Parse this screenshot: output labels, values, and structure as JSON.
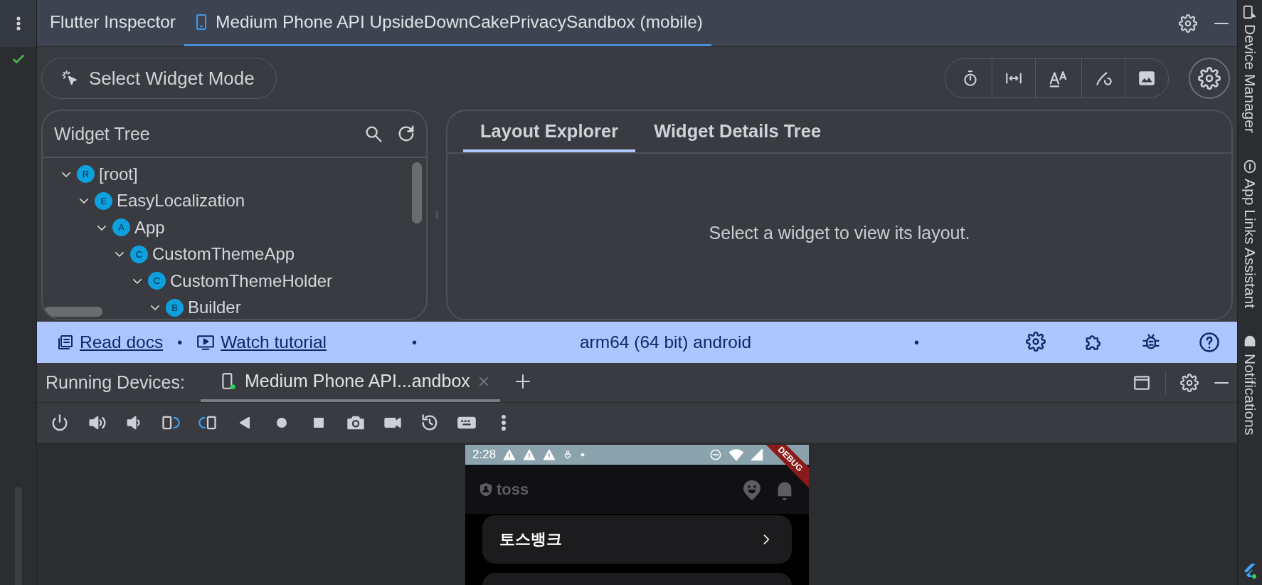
{
  "inspector": {
    "tabs": [
      {
        "label": "Flutter Inspector",
        "selected": false
      },
      {
        "label": "Medium Phone API UpsideDownCakePrivacySandbox (mobile)",
        "selected": true
      }
    ]
  },
  "toolbar": {
    "select_mode": "Select Widget Mode"
  },
  "widget_tree": {
    "title": "Widget Tree",
    "nodes": [
      {
        "badge": "R",
        "label": "[root]",
        "expanded": true,
        "children": [
          {
            "badge": "E",
            "label": "EasyLocalization",
            "expanded": true,
            "children": [
              {
                "badge": "A",
                "label": "App",
                "expanded": true,
                "children": [
                  {
                    "badge": "C",
                    "label": "CustomThemeApp",
                    "expanded": true,
                    "children": [
                      {
                        "badge": "C",
                        "label": "CustomThemeHolder",
                        "expanded": true,
                        "children": [
                          {
                            "badge": "B",
                            "label": "Builder",
                            "expanded": true
                          }
                        ]
                      }
                    ]
                  }
                ]
              }
            ]
          }
        ]
      }
    ]
  },
  "details": {
    "tabs": [
      {
        "label": "Layout Explorer",
        "selected": true
      },
      {
        "label": "Widget Details Tree",
        "selected": false
      }
    ],
    "message": "Select a widget to view its layout."
  },
  "status_bar": {
    "links": [
      "Read docs",
      "Watch tutorial"
    ],
    "separators": [
      "•",
      "•",
      "•"
    ],
    "platform": "arm64 (64 bit) android"
  },
  "running_devices": {
    "title": "Running Devices:",
    "tabs": [
      {
        "label": "Medium Phone API...andbox",
        "selected": true
      }
    ]
  },
  "phone": {
    "time": "2:28",
    "debug_banner": "DEBUG",
    "app_name": "toss",
    "cards": [
      {
        "kind": "menu",
        "title": "토스뱅크"
      },
      {
        "kind": "menu"
      }
    ]
  },
  "side_tools": [
    "Device Manager",
    "App Links Assistant",
    "Notifications"
  ]
}
